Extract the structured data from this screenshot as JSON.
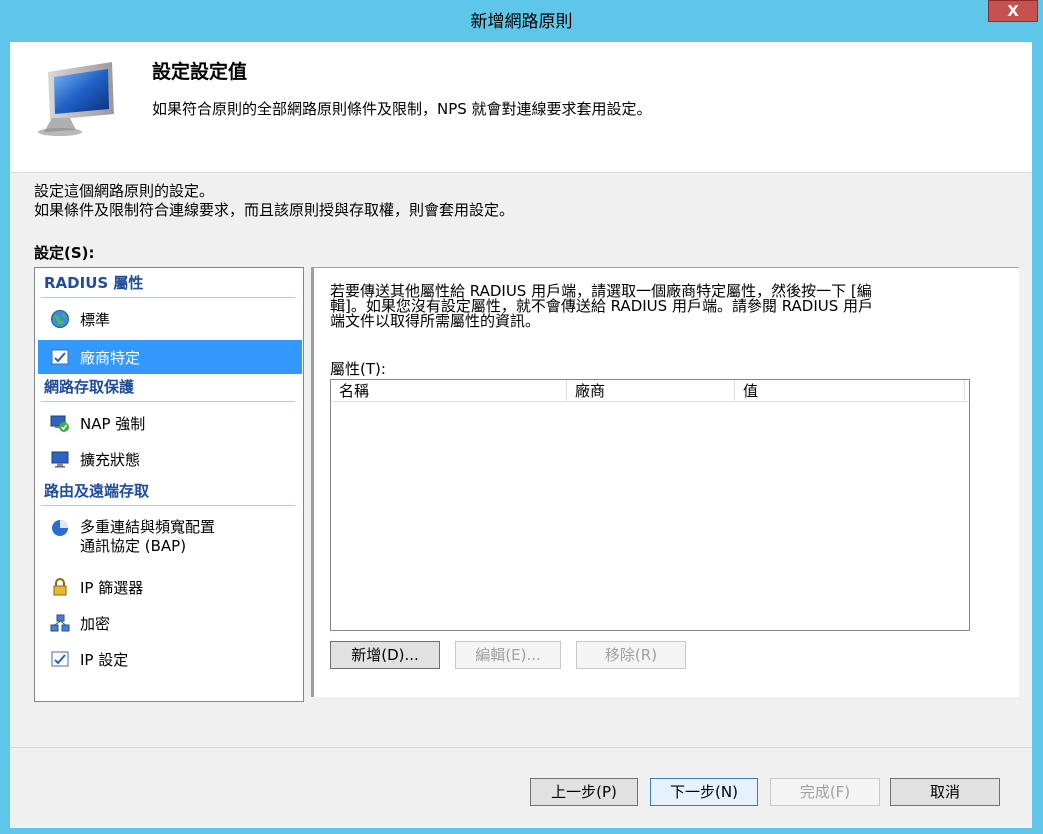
{
  "window": {
    "title": "新增網路原則",
    "close_label": "X"
  },
  "header": {
    "title": "設定設定值",
    "description": "如果符合原則的全部網路原則條件及限制，NPS 就會對連線要求套用設定。"
  },
  "intro": {
    "line1": "設定這個網路原則的設定。",
    "line2": "如果條件及限制符合連線要求，而且該原則授與存取權，則會套用設定。"
  },
  "settings_label": "設定(S):",
  "sidebar": {
    "categories": [
      {
        "label": "RADIUS 屬性"
      },
      {
        "label": "網路存取保護"
      },
      {
        "label": "路由及遠端存取"
      }
    ],
    "items": [
      {
        "label": "標準",
        "icon": "globe-icon"
      },
      {
        "label": "廠商特定",
        "icon": "checklist-icon"
      },
      {
        "label": "NAP 強制",
        "icon": "nap-icon"
      },
      {
        "label": "擴充狀態",
        "icon": "monitor-icon"
      },
      {
        "label_line1": "多重連結與頻寬配置",
        "label_line2": "通訊協定 (BAP)",
        "icon": "pie-icon"
      },
      {
        "label": "IP 篩選器",
        "icon": "lock-icon"
      },
      {
        "label": "加密",
        "icon": "network-icon"
      },
      {
        "label": "IP 設定",
        "icon": "checklist-icon"
      }
    ]
  },
  "main": {
    "description_line1": "若要傳送其他屬性給 RADIUS 用戶端，請選取一個廠商特定屬性，然後按一下 [編",
    "description_line2": "輯]。如果您沒有設定屬性，就不會傳送給 RADIUS 用戶端。請參閱 RADIUS 用戶",
    "description_line3": "端文件以取得所需屬性的資訊。",
    "attributes_label": "屬性(T):",
    "columns": [
      "名稱",
      "廠商",
      "值"
    ],
    "add_button": "新增(D)...",
    "edit_button": "編輯(E)...",
    "remove_button": "移除(R)"
  },
  "footer": {
    "back_button": "上一步(P)",
    "next_button": "下一步(N)",
    "finish_button": "完成(F)",
    "cancel_button": "取消"
  },
  "colors": {
    "titlebar": "#5ec6e8",
    "selection": "#3399ff",
    "category": "#1f4d9c",
    "close": "#c75050"
  }
}
